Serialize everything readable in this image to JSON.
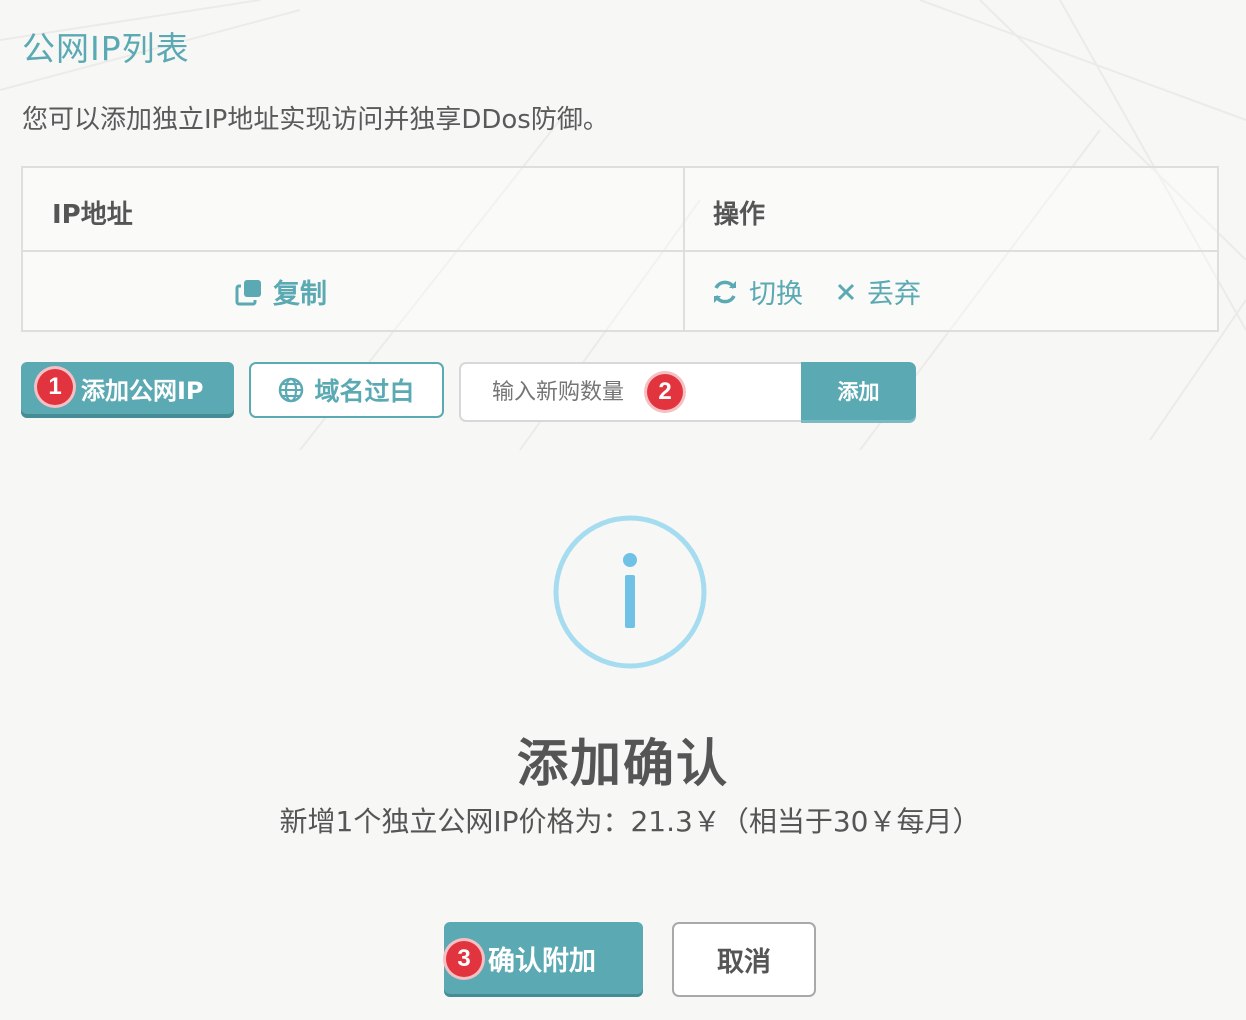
{
  "page": {
    "title": "公网IP列表",
    "description": "您可以添加独立IP地址实现访问并独享DDos防御。"
  },
  "table": {
    "headers": [
      "IP地址",
      "操作"
    ],
    "row": {
      "copy_label": "复制",
      "actions": [
        {
          "icon": "refresh-icon",
          "label": "切换"
        },
        {
          "icon": "close-icon",
          "label": "丢弃"
        }
      ]
    }
  },
  "toolbar": {
    "add_ip_label": "添加公网IP",
    "domain_label": "域名过白",
    "quantity_placeholder": "输入新购数量",
    "add_label": "添加"
  },
  "badges": {
    "one": "1",
    "two": "2",
    "three": "3"
  },
  "dialog": {
    "icon": "info-icon",
    "title": "添加确认",
    "message": "新增1个独立公网IP价格为：21.3￥（相当于30￥每月）",
    "confirm_label": "确认附加",
    "cancel_label": "取消"
  },
  "colors": {
    "accent": "#5aa9b3",
    "badge": "#e2343f",
    "info": "#a6dcf0"
  }
}
